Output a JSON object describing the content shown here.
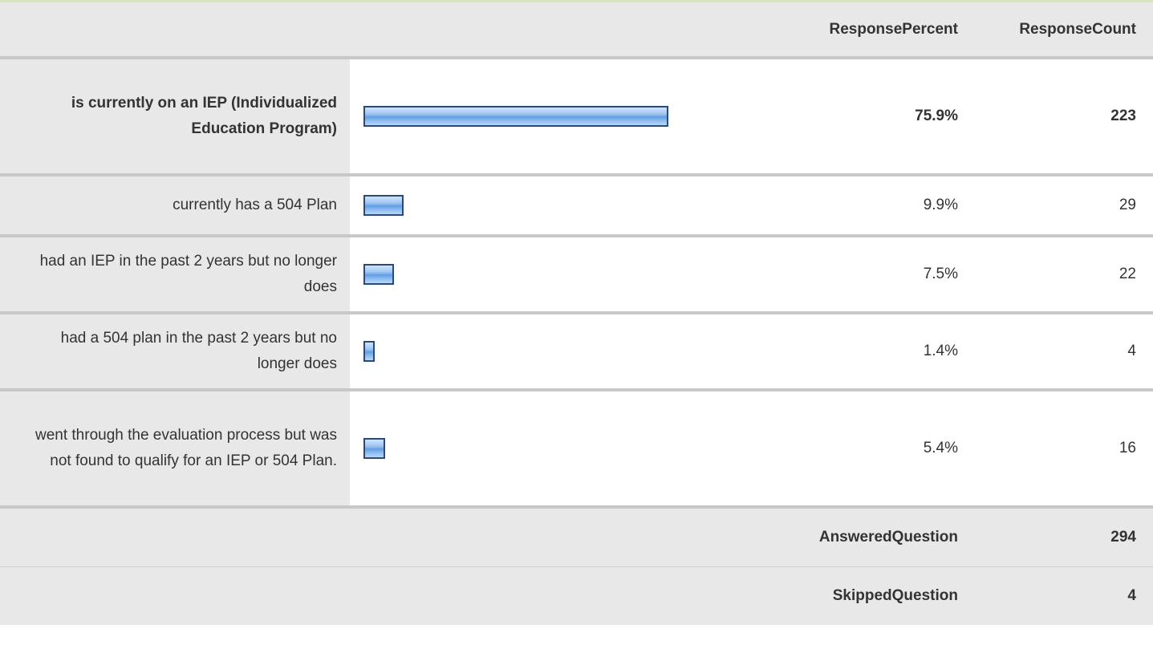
{
  "header": {
    "percent_label": "ResponsePercent",
    "count_label": "ResponseCount"
  },
  "rows": [
    {
      "label": "is currently on an IEP (Individualized Education Program)",
      "percent": "75.9%",
      "count": "223",
      "fraction": 0.759
    },
    {
      "label": "currently has a 504 Plan",
      "percent": "9.9%",
      "count": "29",
      "fraction": 0.099
    },
    {
      "label": "had an IEP in the past 2 years but no longer does",
      "percent": "7.5%",
      "count": "22",
      "fraction": 0.075
    },
    {
      "label": "had a 504 plan in the past 2 years but no longer does",
      "percent": "1.4%",
      "count": "4",
      "fraction": 0.014
    },
    {
      "label": "went through the evaluation process but was not found to qualify for an IEP or 504 Plan.",
      "percent": "5.4%",
      "count": "16",
      "fraction": 0.054
    }
  ],
  "footer": {
    "answered_label": "AnsweredQuestion",
    "answered_value": "294",
    "skipped_label": "SkippedQuestion",
    "skipped_value": "4"
  },
  "colors": {
    "bar_border": "#2a4a78",
    "bar_fill": "#7fb1ec",
    "label_bg": "#e8e8e8"
  }
}
